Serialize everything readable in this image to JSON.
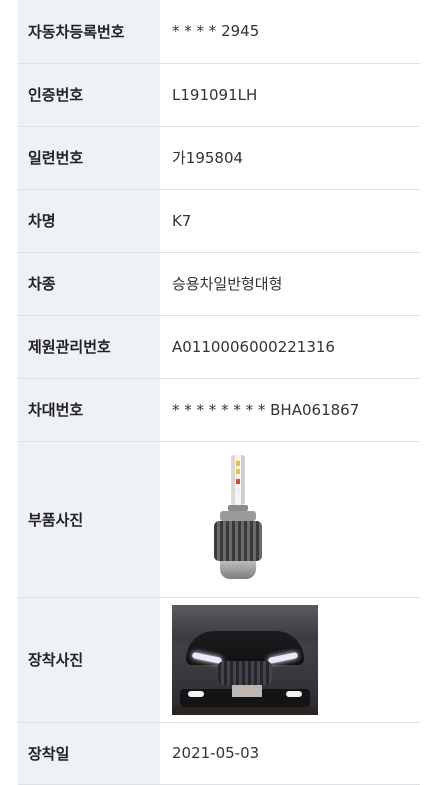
{
  "rows": [
    {
      "label": "자동차등록번호",
      "value": "* * * * 2945"
    },
    {
      "label": "인증번호",
      "value": "L191091LH"
    },
    {
      "label": "일련번호",
      "value": "가195804"
    },
    {
      "label": "차명",
      "value": "K7"
    },
    {
      "label": "차종",
      "value": "승용차일반형대형"
    },
    {
      "label": "제원관리번호",
      "value": "A0110006000221316"
    },
    {
      "label": "차대번호",
      "value": "* * * * * * * * BHA061867"
    },
    {
      "label": "부품사진"
    },
    {
      "label": "장착사진"
    },
    {
      "label": "장착일",
      "value": "2021-05-03"
    }
  ],
  "colors": {
    "label_bg": "#eef1f6",
    "border": "#dde1e6",
    "text": "#333333"
  }
}
